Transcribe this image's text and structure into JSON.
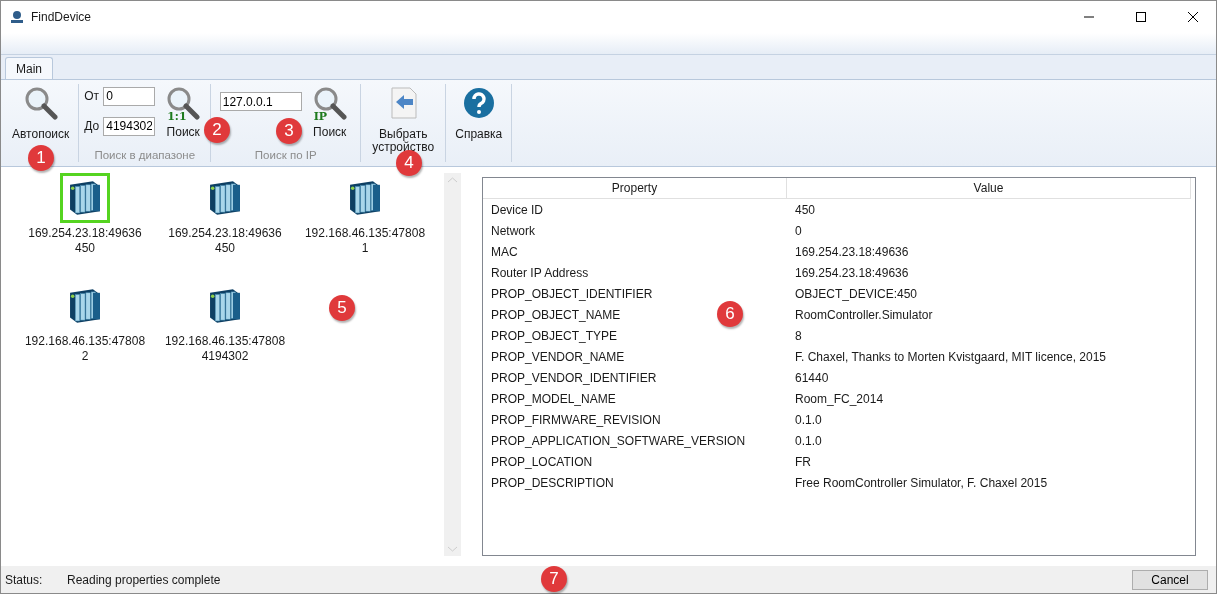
{
  "window": {
    "title": "FindDevice"
  },
  "tabs": [
    {
      "label": "Main",
      "selected": true
    }
  ],
  "ribbon": {
    "autosearch": {
      "label": "Автопоиск"
    },
    "range": {
      "from_label": "От",
      "from_value": "0",
      "to_label": "До",
      "to_value": "4194302",
      "badge": "1:1",
      "button": "Поиск",
      "caption": "Поиск в диапазоне"
    },
    "ip": {
      "value": "127.0.0.1",
      "badge": "IP",
      "button": "Поиск",
      "caption": "Поиск по IP"
    },
    "select": {
      "label": "Выбрать устройство"
    },
    "help": {
      "label": "Справка"
    }
  },
  "devices": [
    {
      "address": "169.254.23.18:49636",
      "id": "450",
      "selected": true
    },
    {
      "address": "169.254.23.18:49636",
      "id": "450",
      "selected": false
    },
    {
      "address": "192.168.46.135:47808",
      "id": "1",
      "selected": false
    },
    {
      "address": "192.168.46.135:47808",
      "id": "2",
      "selected": false
    },
    {
      "address": "192.168.46.135:47808",
      "id": "4194302",
      "selected": false
    }
  ],
  "properties": {
    "columns": [
      "Property",
      "Value"
    ],
    "rows": [
      {
        "property": "Device ID",
        "value": "450"
      },
      {
        "property": "Network",
        "value": "0"
      },
      {
        "property": "MAC",
        "value": "169.254.23.18:49636"
      },
      {
        "property": "Router IP Address",
        "value": "169.254.23.18:49636"
      },
      {
        "property": "PROP_OBJECT_IDENTIFIER",
        "value": "OBJECT_DEVICE:450"
      },
      {
        "property": "PROP_OBJECT_NAME",
        "value": "RoomController.Simulator"
      },
      {
        "property": "PROP_OBJECT_TYPE",
        "value": "8"
      },
      {
        "property": "PROP_VENDOR_NAME",
        "value": "F. Chaxel, Thanks to Morten Kvistgaard, MIT licence, 2015"
      },
      {
        "property": "PROP_VENDOR_IDENTIFIER",
        "value": "61440"
      },
      {
        "property": "PROP_MODEL_NAME",
        "value": "Room_FC_2014"
      },
      {
        "property": "PROP_FIRMWARE_REVISION",
        "value": "0.1.0"
      },
      {
        "property": "PROP_APPLICATION_SOFTWARE_VERSION",
        "value": "0.1.0"
      },
      {
        "property": "PROP_LOCATION",
        "value": "FR"
      },
      {
        "property": "PROP_DESCRIPTION",
        "value": "Free RoomController Simulator, F. Chaxel 2015"
      }
    ]
  },
  "status_bar": {
    "label": "Status:",
    "message": "Reading properties complete",
    "button": "Cancel"
  },
  "callouts": [
    "1",
    "2",
    "3",
    "4",
    "5",
    "6",
    "7"
  ]
}
